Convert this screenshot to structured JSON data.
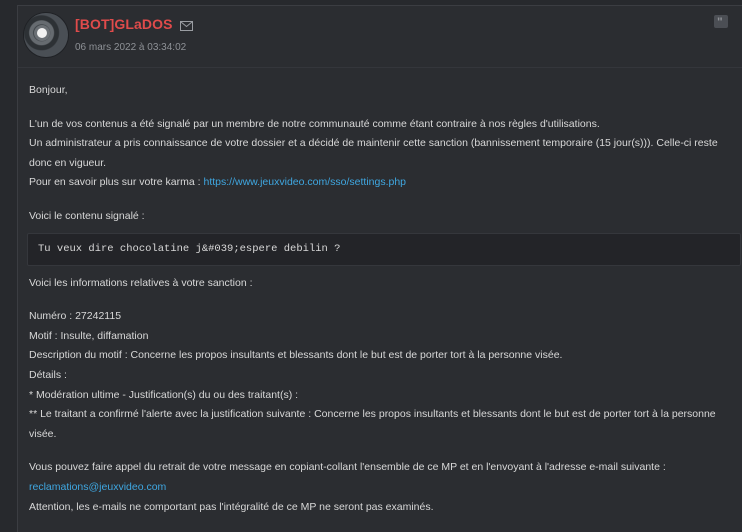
{
  "post": {
    "author": "[BOT]GLaDOS",
    "date": "06 mars 2022 à 03:34:02",
    "icons": {
      "mail": "envelope-icon",
      "quote": "quote-icon",
      "avatar": "avatar-image"
    }
  },
  "message": {
    "greeting": "Bonjour,",
    "p1_l1": "L'un de vos contenus a été signalé par un membre de notre communauté comme étant contraire à nos règles d'utilisations.",
    "p1_l2": "Un administrateur a pris connaissance de votre dossier et a décidé de maintenir cette sanction (bannissement temporaire (15 jour(s))). Celle-ci reste donc en vigueur.",
    "p1_l3_prefix": "Pour en savoir plus sur votre karma : ",
    "karma_link": "https://www.jeuxvideo.com/sso/settings.php",
    "reported_title": "Voici le contenu signalé :",
    "reported_content": "Tu veux dire chocolatine j&#039;espere debilin ?",
    "sanction_title": "Voici les informations relatives à votre sanction :",
    "numero": "Numéro : 27242115",
    "motif": "Motif : Insulte, diffamation",
    "description": "Description du motif : Concerne les propos insultants et blessants dont le but est de porter tort à la personne visée.",
    "details": "Détails :",
    "moderation": "* Modération ultime - Justification(s) du ou des traitant(s) :",
    "traitant": "** Le traitant a confirmé l'alerte avec la justification suivante : Concerne les propos insultants et blessants dont le but est de porter tort à la personne visée.",
    "appeal": "Vous pouvez faire appel du retrait de votre message en copiant-collant l'ensemble de ce MP et en l'envoyant à l'adresse e-mail suivante :",
    "email": "reclamations@jeuxvideo.com",
    "warning": "Attention, les e-mails ne comportant pas l'intégralité de ce MP ne seront pas examinés."
  },
  "colors": {
    "background": "#27292d",
    "card": "#2b2d31",
    "author": "#e04b4b",
    "link": "#3fa7e1",
    "text": "#d8d8d8",
    "date": "#8e9196"
  }
}
